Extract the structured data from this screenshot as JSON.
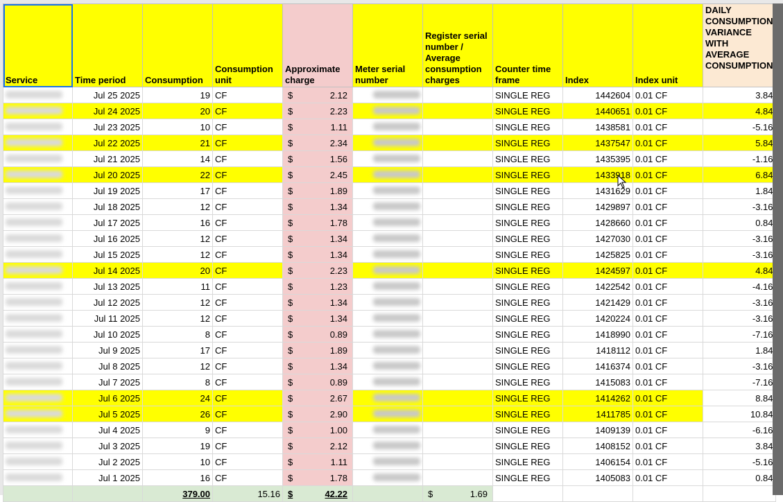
{
  "headers": {
    "service": "Service",
    "time_period": "Time period",
    "consumption": "Consumption",
    "consumption_unit": "Consumption unit",
    "approximate_charge": "Approximate charge",
    "meter_serial": "Meter serial number",
    "register_serial": "Register serial number / Average consumption charges",
    "counter_time_frame": "Counter time frame",
    "index": "Index",
    "index_unit": "Index unit",
    "daily_variance": "DAILY CONSUMPTION VARIANCE WITH AVERAGE CONSUMPTION"
  },
  "currency_symbol": "$",
  "rows": [
    {
      "date": "Jul 25 2025",
      "consumption": "19",
      "unit": "CF",
      "charge": "2.12",
      "time_frame": "SINGLE REG",
      "index": "1442604",
      "index_unit": "0.01 CF",
      "variance": "3.84",
      "highlight": "none"
    },
    {
      "date": "Jul 24 2025",
      "consumption": "20",
      "unit": "CF",
      "charge": "2.23",
      "time_frame": "SINGLE REG",
      "index": "1440651",
      "index_unit": "0.01 CF",
      "variance": "4.84",
      "highlight": "full"
    },
    {
      "date": "Jul 23 2025",
      "consumption": "10",
      "unit": "CF",
      "charge": "1.11",
      "time_frame": "SINGLE REG",
      "index": "1438581",
      "index_unit": "0.01 CF",
      "variance": "-5.16",
      "highlight": "none"
    },
    {
      "date": "Jul 22 2025",
      "consumption": "21",
      "unit": "CF",
      "charge": "2.34",
      "time_frame": "SINGLE REG",
      "index": "1437547",
      "index_unit": "0.01 CF",
      "variance": "5.84",
      "highlight": "full"
    },
    {
      "date": "Jul 21 2025",
      "consumption": "14",
      "unit": "CF",
      "charge": "1.56",
      "time_frame": "SINGLE REG",
      "index": "1435395",
      "index_unit": "0.01 CF",
      "variance": "-1.16",
      "highlight": "none"
    },
    {
      "date": "Jul 20 2025",
      "consumption": "22",
      "unit": "CF",
      "charge": "2.45",
      "time_frame": "SINGLE REG",
      "index": "1433918",
      "index_unit": "0.01 CF",
      "variance": "6.84",
      "highlight": "full"
    },
    {
      "date": "Jul 19 2025",
      "consumption": "17",
      "unit": "CF",
      "charge": "1.89",
      "time_frame": "SINGLE REG",
      "index": "1431629",
      "index_unit": "0.01 CF",
      "variance": "1.84",
      "highlight": "none"
    },
    {
      "date": "Jul 18 2025",
      "consumption": "12",
      "unit": "CF",
      "charge": "1.34",
      "time_frame": "SINGLE REG",
      "index": "1429897",
      "index_unit": "0.01 CF",
      "variance": "-3.16",
      "highlight": "none"
    },
    {
      "date": "Jul 17 2025",
      "consumption": "16",
      "unit": "CF",
      "charge": "1.78",
      "time_frame": "SINGLE REG",
      "index": "1428660",
      "index_unit": "0.01 CF",
      "variance": "0.84",
      "highlight": "none"
    },
    {
      "date": "Jul 16 2025",
      "consumption": "12",
      "unit": "CF",
      "charge": "1.34",
      "time_frame": "SINGLE REG",
      "index": "1427030",
      "index_unit": "0.01 CF",
      "variance": "-3.16",
      "highlight": "none"
    },
    {
      "date": "Jul 15 2025",
      "consumption": "12",
      "unit": "CF",
      "charge": "1.34",
      "time_frame": "SINGLE REG",
      "index": "1425825",
      "index_unit": "0.01 CF",
      "variance": "-3.16",
      "highlight": "none"
    },
    {
      "date": "Jul 14 2025",
      "consumption": "20",
      "unit": "CF",
      "charge": "2.23",
      "time_frame": "SINGLE REG",
      "index": "1424597",
      "index_unit": "0.01 CF",
      "variance": "4.84",
      "highlight": "full"
    },
    {
      "date": "Jul 13 2025",
      "consumption": "11",
      "unit": "CF",
      "charge": "1.23",
      "time_frame": "SINGLE REG",
      "index": "1422542",
      "index_unit": "0.01 CF",
      "variance": "-4.16",
      "highlight": "none"
    },
    {
      "date": "Jul 12 2025",
      "consumption": "12",
      "unit": "CF",
      "charge": "1.34",
      "time_frame": "SINGLE REG",
      "index": "1421429",
      "index_unit": "0.01 CF",
      "variance": "-3.16",
      "highlight": "none"
    },
    {
      "date": "Jul 11 2025",
      "consumption": "12",
      "unit": "CF",
      "charge": "1.34",
      "time_frame": "SINGLE REG",
      "index": "1420224",
      "index_unit": "0.01 CF",
      "variance": "-3.16",
      "highlight": "none"
    },
    {
      "date": "Jul 10 2025",
      "consumption": "8",
      "unit": "CF",
      "charge": "0.89",
      "time_frame": "SINGLE REG",
      "index": "1418990",
      "index_unit": "0.01 CF",
      "variance": "-7.16",
      "highlight": "none"
    },
    {
      "date": "Jul 9 2025",
      "consumption": "17",
      "unit": "CF",
      "charge": "1.89",
      "time_frame": "SINGLE REG",
      "index": "1418112",
      "index_unit": "0.01 CF",
      "variance": "1.84",
      "highlight": "none"
    },
    {
      "date": "Jul 8 2025",
      "consumption": "12",
      "unit": "CF",
      "charge": "1.34",
      "time_frame": "SINGLE REG",
      "index": "1416374",
      "index_unit": "0.01 CF",
      "variance": "-3.16",
      "highlight": "none"
    },
    {
      "date": "Jul 7 2025",
      "consumption": "8",
      "unit": "CF",
      "charge": "0.89",
      "time_frame": "SINGLE REG",
      "index": "1415083",
      "index_unit": "0.01 CF",
      "variance": "-7.16",
      "highlight": "none"
    },
    {
      "date": "Jul 6 2025",
      "consumption": "24",
      "unit": "CF",
      "charge": "2.67",
      "time_frame": "SINGLE REG",
      "index": "1414262",
      "index_unit": "0.01 CF",
      "variance": "8.84",
      "highlight": "partial"
    },
    {
      "date": "Jul 5 2025",
      "consumption": "26",
      "unit": "CF",
      "charge": "2.90",
      "time_frame": "SINGLE REG",
      "index": "1411785",
      "index_unit": "0.01 CF",
      "variance": "10.84",
      "highlight": "partial"
    },
    {
      "date": "Jul 4 2025",
      "consumption": "9",
      "unit": "CF",
      "charge": "1.00",
      "time_frame": "SINGLE REG",
      "index": "1409139",
      "index_unit": "0.01 CF",
      "variance": "-6.16",
      "highlight": "none"
    },
    {
      "date": "Jul 3 2025",
      "consumption": "19",
      "unit": "CF",
      "charge": "2.12",
      "time_frame": "SINGLE REG",
      "index": "1408152",
      "index_unit": "0.01 CF",
      "variance": "3.84",
      "highlight": "none"
    },
    {
      "date": "Jul 2 2025",
      "consumption": "10",
      "unit": "CF",
      "charge": "1.11",
      "time_frame": "SINGLE REG",
      "index": "1406154",
      "index_unit": "0.01 CF",
      "variance": "-5.16",
      "highlight": "none"
    },
    {
      "date": "Jul 1 2025",
      "consumption": "16",
      "unit": "CF",
      "charge": "1.78",
      "time_frame": "SINGLE REG",
      "index": "1405083",
      "index_unit": "0.01 CF",
      "variance": "0.84",
      "highlight": "none"
    }
  ],
  "totals": {
    "consumption_total": "379.00",
    "consumption_unit_value": "15.16",
    "charge_total": "42.22",
    "avg_charge": "1.69"
  },
  "colors": {
    "highlight": "#ffff00",
    "charge_column": "#f4cccc",
    "total_row": "#d9ead3"
  }
}
